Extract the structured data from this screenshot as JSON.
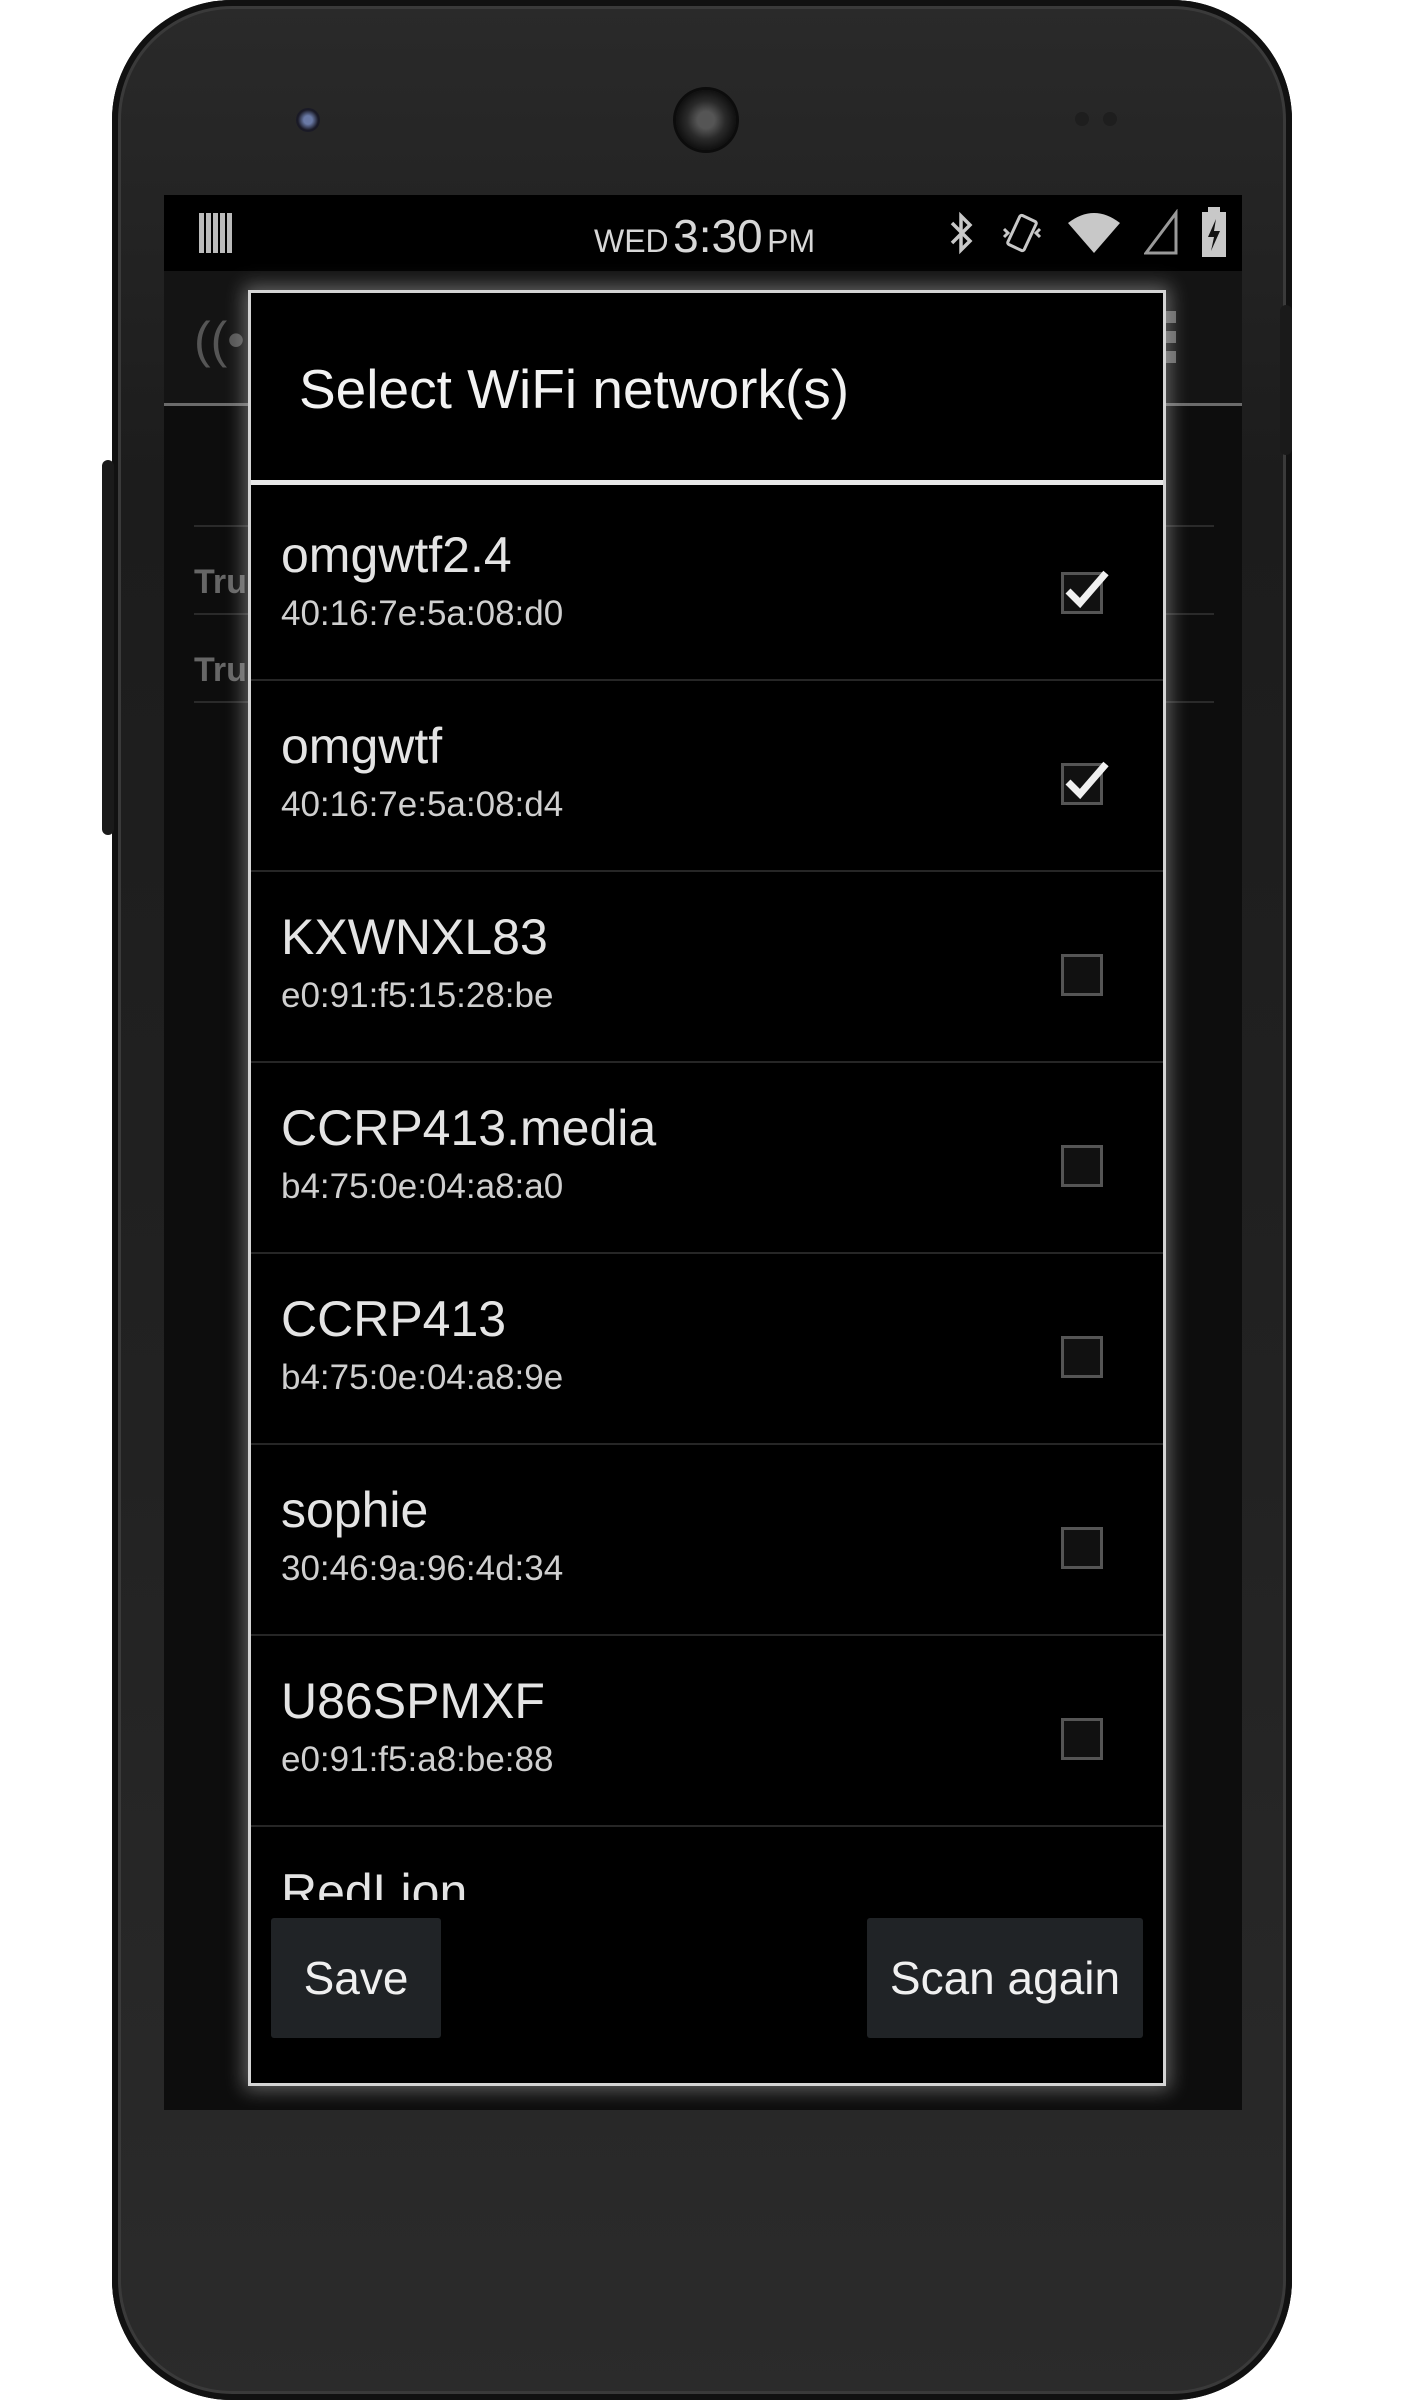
{
  "status_bar": {
    "day": "WED",
    "time": "3:30",
    "ampm": "PM",
    "icons": [
      "barcode-notification-icon",
      "bluetooth-icon",
      "vibrate-icon",
      "wifi-icon",
      "signal-icon",
      "battery-charging-icon"
    ]
  },
  "background": {
    "rows": [
      "Tru",
      "Tru"
    ]
  },
  "dialog": {
    "title": "Select WiFi network(s)",
    "networks": [
      {
        "ssid": "omgwtf2.4",
        "bssid": "40:16:7e:5a:08:d0",
        "checked": true
      },
      {
        "ssid": "omgwtf",
        "bssid": "40:16:7e:5a:08:d4",
        "checked": true
      },
      {
        "ssid": "KXWNXL83",
        "bssid": "e0:91:f5:15:28:be",
        "checked": false
      },
      {
        "ssid": "CCRP413.media",
        "bssid": "b4:75:0e:04:a8:a0",
        "checked": false
      },
      {
        "ssid": "CCRP413",
        "bssid": "b4:75:0e:04:a8:9e",
        "checked": false
      },
      {
        "ssid": "sophie",
        "bssid": "30:46:9a:96:4d:34",
        "checked": false
      },
      {
        "ssid": "U86SPMXF",
        "bssid": "e0:91:f5:a8:be:88",
        "checked": false
      },
      {
        "ssid": "RedLion",
        "bssid": "",
        "checked": false
      }
    ],
    "buttons": {
      "save": "Save",
      "scan_again": "Scan again"
    }
  }
}
